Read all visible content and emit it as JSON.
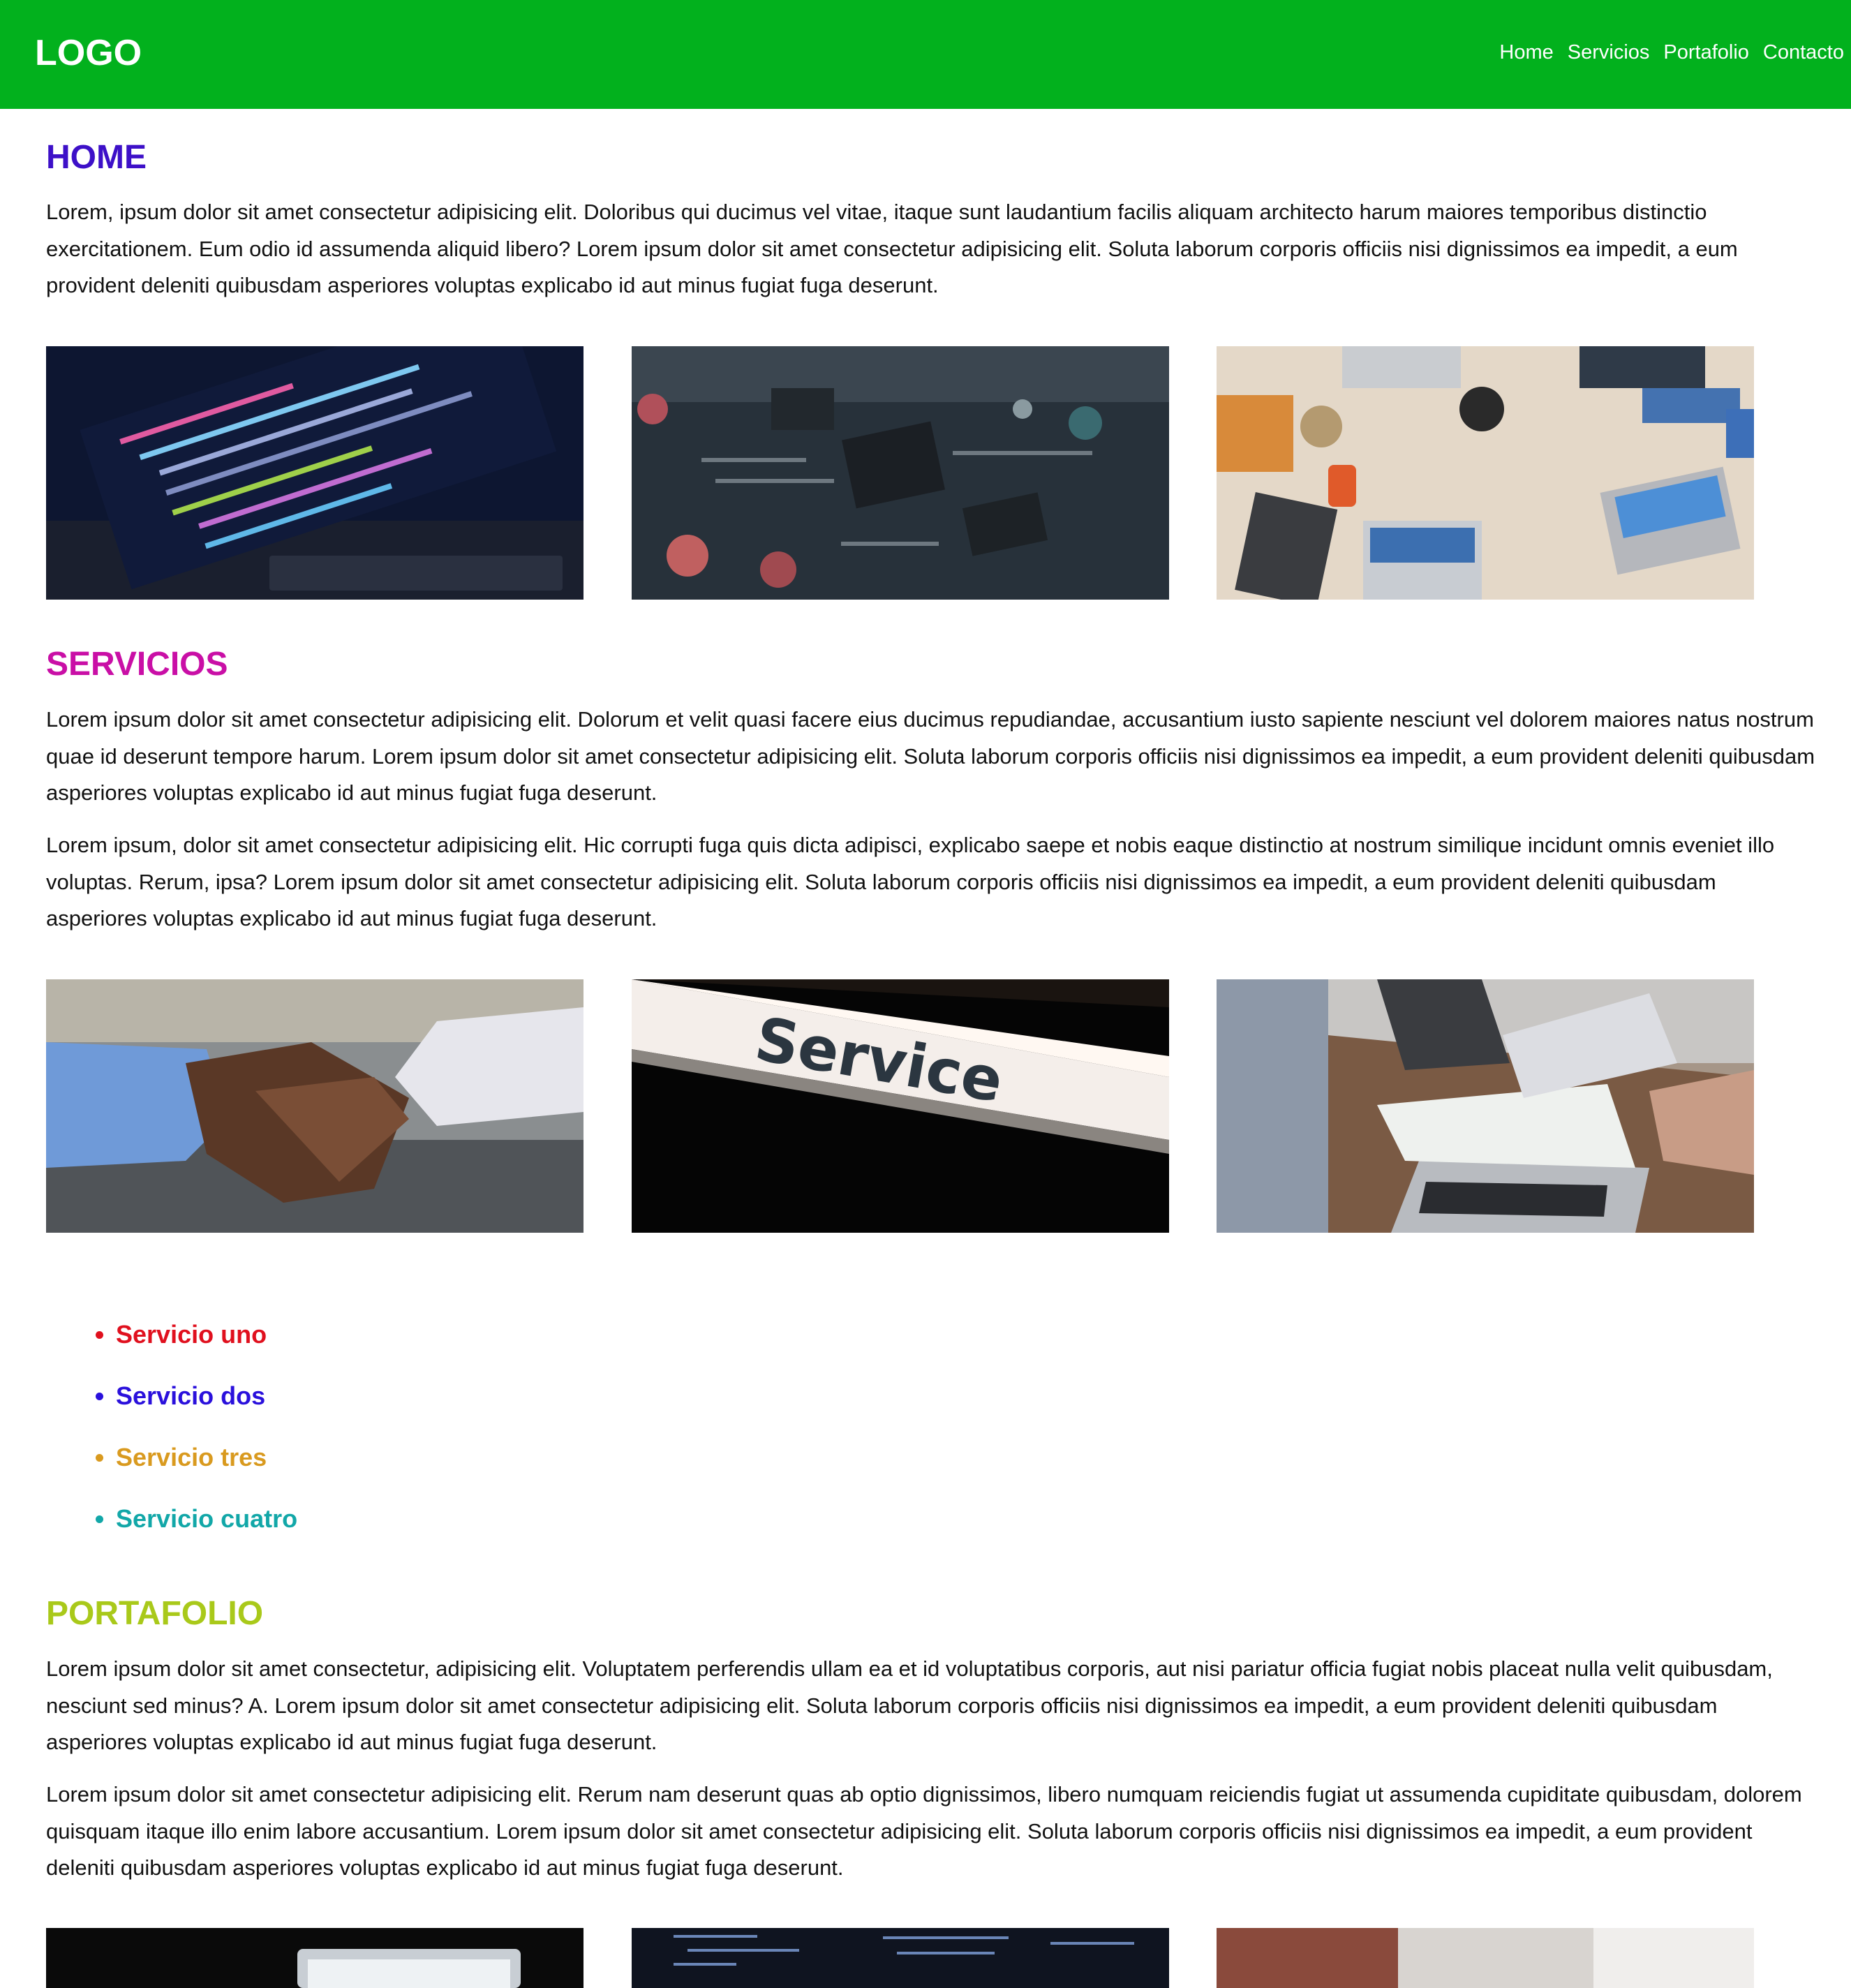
{
  "header": {
    "logo": "LOGO",
    "nav": [
      {
        "label": "Home"
      },
      {
        "label": "Servicios"
      },
      {
        "label": "Portafolio"
      },
      {
        "label": "Contacto"
      }
    ]
  },
  "home": {
    "title": "HOME",
    "title_color": "#3d10c8",
    "paragraph": "Lorem, ipsum dolor sit amet consectetur adipisicing elit. Doloribus qui ducimus vel vitae, itaque sunt laudantium facilis aliquam architecto harum maiores temporibus distinctio exercitationem. Eum odio id assumenda aliquid libero? Lorem ipsum dolor sit amet consectetur adipisicing elit. Soluta laborum corporis officiis nisi dignissimos ea impedit, a eum provident deleniti quibusdam asperiores voluptas explicabo id aut minus fugiat fuga deserunt.",
    "images": [
      "code-on-laptop-photo",
      "circuit-board-photo",
      "team-laptops-desk-photo"
    ]
  },
  "servicios": {
    "title": "SERVICIOS",
    "title_color": "#c90fa6",
    "paragraphs": [
      "Lorem ipsum dolor sit amet consectetur adipisicing elit. Dolorum et velit quasi facere eius ducimus repudiandae, accusantium iusto sapiente nesciunt vel dolorem maiores natus nostrum quae id deserunt tempore harum. Lorem ipsum dolor sit amet consectetur adipisicing elit. Soluta laborum corporis officiis nisi dignissimos ea impedit, a eum provident deleniti quibusdam asperiores voluptas explicabo id aut minus fugiat fuga deserunt.",
      "Lorem ipsum, dolor sit amet consectetur adipisicing elit. Hic corrupti fuga quis dicta adipisci, explicabo saepe et nobis eaque distinctio at nostrum similique incidunt omnis eveniet illo voluptas. Rerum, ipsa? Lorem ipsum dolor sit amet consectetur adipisicing elit. Soluta laborum corporis officiis nisi dignissimos ea impedit, a eum provident deleniti quibusdam asperiores voluptas explicabo id aut minus fugiat fuga deserunt."
    ],
    "images": [
      "handshake-photo",
      "service-sign-photo",
      "meeting-laptops-photo"
    ],
    "service_sign_text": "Service",
    "list": [
      {
        "label": "Servicio uno",
        "color": "#e0101e"
      },
      {
        "label": "Servicio dos",
        "color": "#2a10dc"
      },
      {
        "label": "Servicio tres",
        "color": "#d99a1f"
      },
      {
        "label": "Servicio cuatro",
        "color": "#12a7a8"
      }
    ]
  },
  "portafolio": {
    "title": "PORTAFOLIO",
    "title_color": "#a9c91a",
    "paragraphs": [
      "Lorem ipsum dolor sit amet consectetur, adipisicing elit. Voluptatem perferendis ullam ea et id voluptatibus corporis, aut nisi pariatur officia fugiat nobis placeat nulla velit quibusdam, nesciunt sed minus? A. Lorem ipsum dolor sit amet consectetur adipisicing elit. Soluta laborum corporis officiis nisi dignissimos ea impedit, a eum provident deleniti quibusdam asperiores voluptas explicabo id aut minus fugiat fuga deserunt.",
      "Lorem ipsum dolor sit amet consectetur adipisicing elit. Rerum nam deserunt quas ab optio dignissimos, libero numquam reiciendis fugiat ut assumenda cupiditate quibusdam, dolorem quisquam itaque illo enim labore accusantium. Lorem ipsum dolor sit amet consectetur adipisicing elit. Soluta laborum corporis officiis nisi dignissimos ea impedit, a eum provident deleniti quibusdam asperiores voluptas explicabo id aut minus fugiat fuga deserunt."
    ],
    "images": [
      "laptop-screen-photo",
      "code-monitor-photo",
      "office-chair-photo"
    ]
  }
}
